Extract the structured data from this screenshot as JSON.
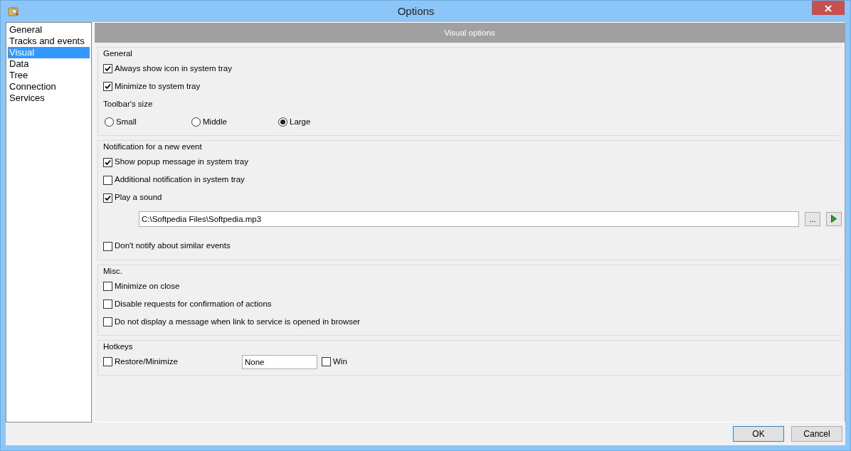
{
  "window": {
    "title": "Options"
  },
  "sidebar": {
    "items": [
      {
        "label": "General",
        "selected": false
      },
      {
        "label": "Tracks and events",
        "selected": false
      },
      {
        "label": "Visual",
        "selected": true
      },
      {
        "label": "Data",
        "selected": false
      },
      {
        "label": "Tree",
        "selected": false
      },
      {
        "label": "Connection",
        "selected": false
      },
      {
        "label": "Services",
        "selected": false
      }
    ]
  },
  "panel": {
    "header": "Visual options",
    "sections": [
      {
        "title": "General",
        "items": [
          {
            "kind": "checkbox",
            "label": "Always show icon in system tray",
            "checked": true
          },
          {
            "kind": "checkbox",
            "label": "Minimize to system tray",
            "checked": true
          },
          {
            "kind": "label",
            "label": "Toolbar's size"
          },
          {
            "kind": "radios",
            "options": [
              {
                "label": "Small",
                "selected": false
              },
              {
                "label": "Middle",
                "selected": false
              },
              {
                "label": "Large",
                "selected": true
              }
            ]
          }
        ]
      },
      {
        "title": "Notification for a new event",
        "items": [
          {
            "kind": "checkbox",
            "label": "Show popup message in system tray",
            "checked": true
          },
          {
            "kind": "checkbox",
            "label": "Additional notification in system tray",
            "checked": false
          },
          {
            "kind": "checkbox",
            "label": "Play a sound",
            "checked": true
          },
          {
            "kind": "file",
            "value": "C:\\Softpedia Files\\Softpedia.mp3",
            "browse": "..."
          },
          {
            "kind": "checkbox",
            "label": "Don't notify about similar events",
            "checked": false
          }
        ]
      },
      {
        "title": "Misc.",
        "items": [
          {
            "kind": "checkbox",
            "label": "Minimize on close",
            "checked": false
          },
          {
            "kind": "checkbox",
            "label": "Disable requests for confirmation of actions",
            "checked": false
          },
          {
            "kind": "checkbox",
            "label": "Do not display a message when link to service is opened in browser",
            "checked": false
          }
        ]
      },
      {
        "title": "Hotkeys",
        "items": [
          {
            "kind": "hotkey",
            "label": "Restore/Minimize",
            "checked": false,
            "value": "None",
            "modifier": {
              "label": "Win",
              "checked": false
            }
          }
        ]
      }
    ]
  },
  "buttons": [
    {
      "label": "OK",
      "default": true
    },
    {
      "label": "Cancel",
      "default": false
    }
  ]
}
